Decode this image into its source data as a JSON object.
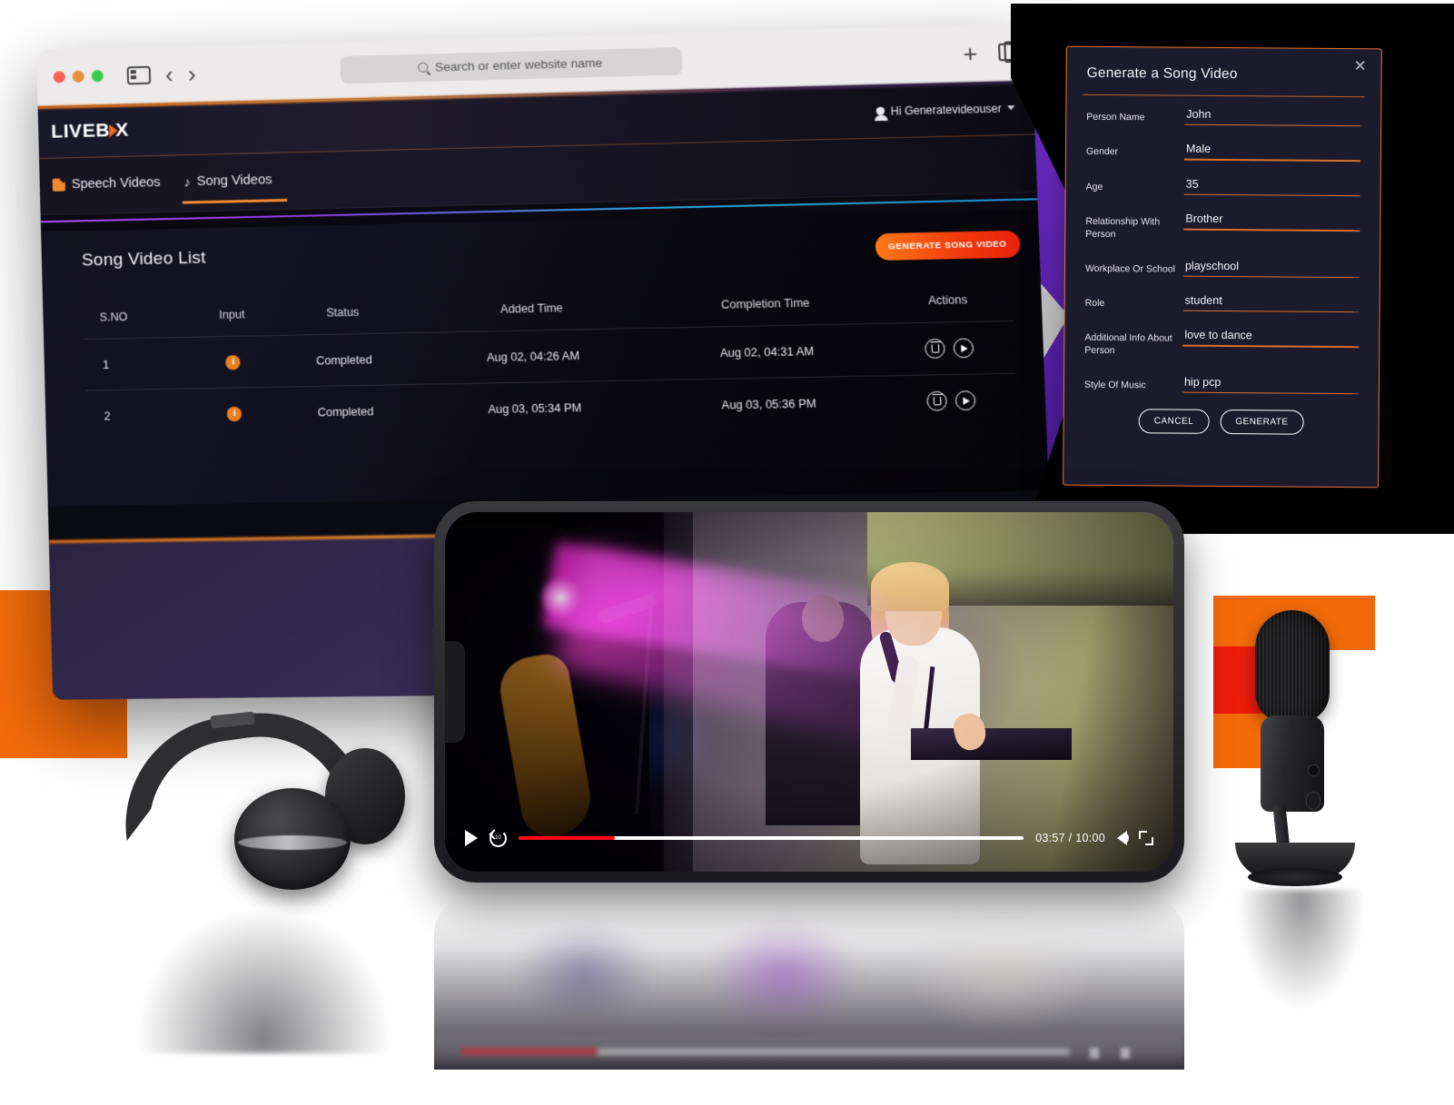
{
  "browser": {
    "traffic_lights": [
      "close",
      "minimize",
      "zoom"
    ],
    "sidebar_icon": "sidebar-icon",
    "back_label": "‹",
    "forward_label": "›",
    "address_placeholder": "Search or enter website name",
    "search_icon": "search-icon",
    "new_tab_label": "+",
    "tab_overview_icon": "copy-tabs-icon"
  },
  "app": {
    "logo_left": "LIVEB",
    "logo_right": "X",
    "user_greeting": "Hi Generatevideouser",
    "tabs": [
      {
        "label": "Speech Videos",
        "icon": "speech-icon",
        "active": false
      },
      {
        "label": "Song Videos",
        "icon": "music-note-icon",
        "active": true
      }
    ],
    "panel_title": "Song Video List",
    "generate_button": "GENERATE SONG VIDEO",
    "table": {
      "columns": [
        "S.NO",
        "Input",
        "Status",
        "Added Time",
        "Completion Time",
        "Actions"
      ],
      "rows": [
        {
          "sno": "1",
          "input_icon": "info-icon",
          "status": "Completed",
          "added_time": "Aug 02, 04:26 AM",
          "completion_time": "Aug 02, 04:31 AM",
          "actions": [
            "delete-icon",
            "play-icon"
          ]
        },
        {
          "sno": "2",
          "input_icon": "info-icon",
          "status": "Completed",
          "added_time": "Aug 03, 05:34 PM",
          "completion_time": "Aug 03, 05:36 PM",
          "actions": [
            "delete-icon",
            "play-icon"
          ]
        }
      ]
    }
  },
  "modal": {
    "title": "Generate a Song Video",
    "close_label": "✕",
    "fields": [
      {
        "label": "Person Name",
        "value": "John"
      },
      {
        "label": "Gender",
        "value": "Male"
      },
      {
        "label": "Age",
        "value": "35"
      },
      {
        "label": "Relationship With Person",
        "value": "Brother"
      },
      {
        "label": "Workplace Or School",
        "value": "playschool"
      },
      {
        "label": "Role",
        "value": "student"
      },
      {
        "label": "Additional Info About Person",
        "value": "love to dance"
      },
      {
        "label": "Style Of Music",
        "value": "hip pcp"
      }
    ],
    "cancel_button": "CANCEL",
    "generate_button": "GENERATE"
  },
  "player": {
    "play_icon": "play-icon",
    "replay_icon": "replay-10-icon",
    "current_time": "03:57",
    "duration": "10:00",
    "time_display": "03:57 / 10:00",
    "progress_percent": 19,
    "volume_icon": "volume-icon",
    "fullscreen_icon": "fullscreen-icon"
  },
  "colors": {
    "accent_orange": "#f26a0a",
    "accent_red": "#ec1c0d",
    "status_green": "#49c96b",
    "purple": "#8b3dfb",
    "modal_bg": "#1c1b2e",
    "progress_red": "#ff0a16"
  },
  "props": {
    "headphones": "headphones-product-image",
    "microphone": "microphone-product-image",
    "phone": "smartphone-video-player"
  }
}
